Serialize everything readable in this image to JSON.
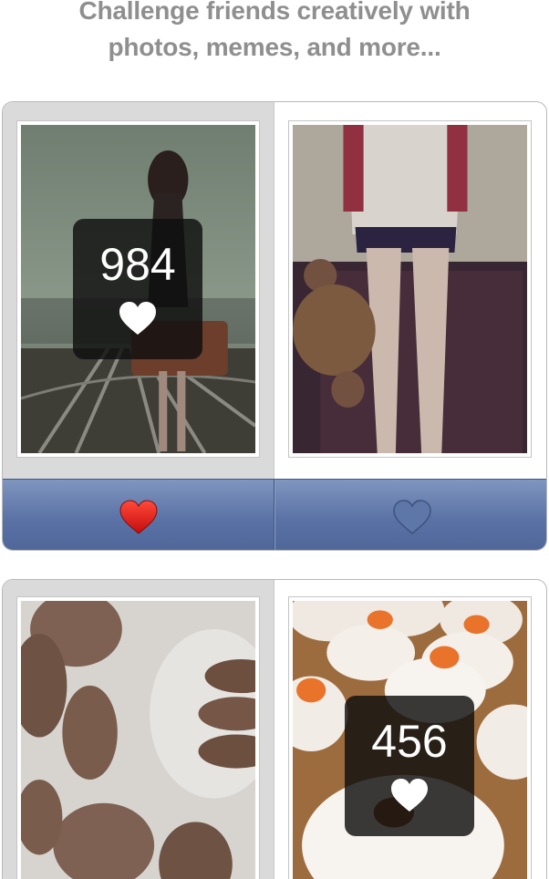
{
  "headline": {
    "line1": "Challenge friends creatively with",
    "line2": "photos, memes, and more..."
  },
  "challenges": [
    {
      "left": {
        "photo": "girl-with-suitcase-on-railway-photo",
        "votes": "984",
        "selected": true
      },
      "right": {
        "photo": "girl-sitting-with-teddy-bear-photo",
        "selected": false
      },
      "vote_bar": {
        "left_icon": "heart-icon-filled-red",
        "right_icon": "heart-icon-outline"
      }
    },
    {
      "left": {
        "photo": "chocolate-macarons-photo",
        "selected": true
      },
      "right": {
        "photo": "pumpkin-cupcakes-photo",
        "votes": "456",
        "selected": false
      }
    }
  ],
  "colors": {
    "headline": "#8f8f8f",
    "vote_bar": "#5b72a6",
    "selected_panel": "#dadada",
    "heart_active": "#e01515",
    "heart_inactive": "#5d78a8",
    "badge": "#0f0f0f"
  }
}
